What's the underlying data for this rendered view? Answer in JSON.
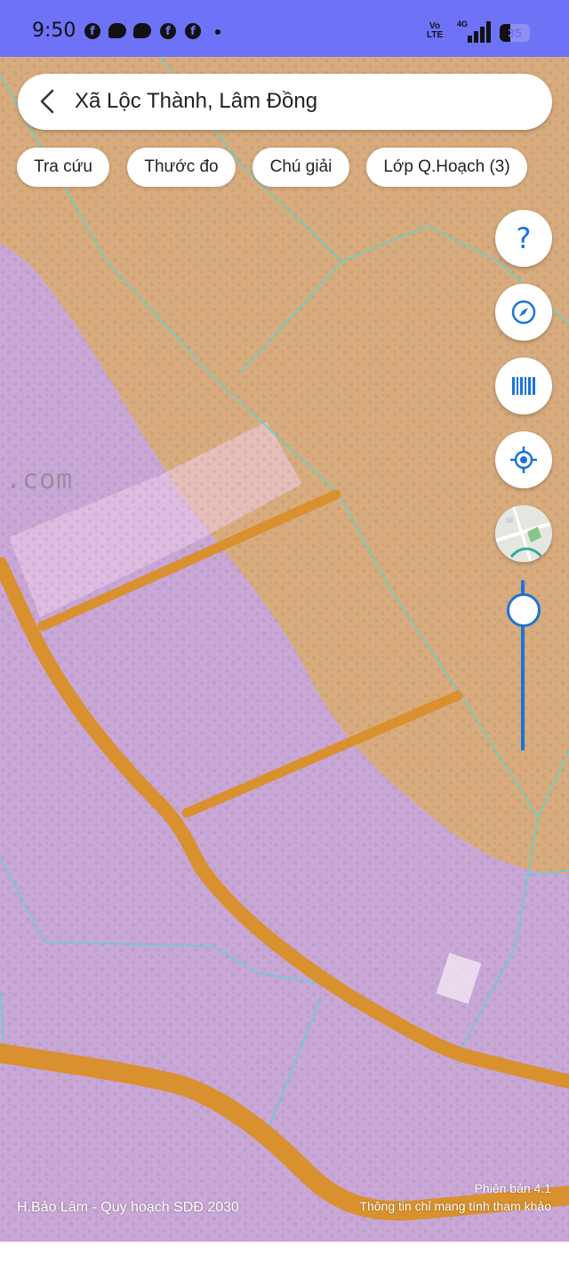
{
  "status_bar": {
    "time": "9:50",
    "notification_icons": [
      "facebook-icon",
      "messenger-icon",
      "messenger-icon",
      "facebook-icon",
      "facebook-icon"
    ],
    "volte_line1": "Vo",
    "volte_line2": "LTE",
    "network": "4G",
    "battery": "35",
    "battery_fraction": 0.35
  },
  "search": {
    "title": "Xã Lộc Thành, Lâm Đồng"
  },
  "chips": [
    {
      "label": "Tra cứu"
    },
    {
      "label": "Thước đo"
    },
    {
      "label": "Chú giải"
    },
    {
      "label": "Lớp Q.Hoạch (3)"
    }
  ],
  "map_controls": {
    "help_symbol": "?",
    "icons": [
      "help-icon",
      "compass-icon",
      "barcode-icon",
      "my-location-icon",
      "basemap-icon"
    ],
    "accent_color": "#1a73d9",
    "zoom_level_fraction": 0.84
  },
  "map": {
    "watermark": ".com",
    "credit": "H.Bảo Lâm - Quy hoạch SDĐ 2030",
    "version": "Phiên bản 4.1",
    "disclaimer": "Thông tin chỉ mang tính tham khảo",
    "colors": {
      "agricultural_land": "#c9a7d6",
      "forest_land": "#d9ac7e",
      "road": "#d9902e",
      "parcel_border": "#5fd4c8"
    }
  }
}
